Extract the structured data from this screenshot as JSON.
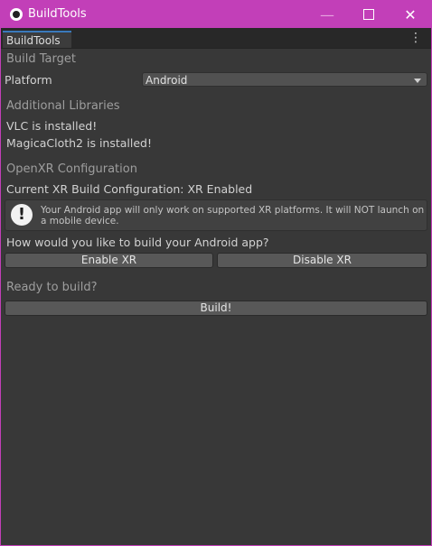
{
  "window": {
    "title": "BuildTools",
    "minimize_glyph": "—",
    "close_glyph": "✕"
  },
  "tabs": [
    {
      "label": "BuildTools"
    }
  ],
  "menu_glyph": "⋮",
  "build_target": {
    "header": "Build Target",
    "platform_label": "Platform",
    "platform_value": "Android"
  },
  "libraries": {
    "header": "Additional Libraries",
    "items": [
      "VLC is installed!",
      "MagicaCloth2 is installed!"
    ]
  },
  "openxr": {
    "header": "OpenXR Configuration",
    "status": "Current XR Build Configuration: XR Enabled",
    "warning_glyph": "!",
    "warning": "Your Android app will only work on supported XR platforms. It will NOT launch on a mobile device.",
    "question": "How would you like to build your Android app?",
    "enable_label": "Enable XR",
    "disable_label": "Disable XR"
  },
  "build": {
    "header": "Ready to build?",
    "button_label": "Build!"
  },
  "colors": {
    "titlebar": "#c23fb8",
    "panel": "#383838",
    "tab_accent": "#3a79bb"
  }
}
